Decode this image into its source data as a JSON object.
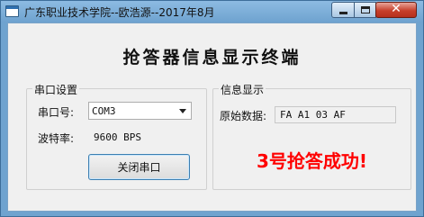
{
  "window": {
    "title": "广东职业技术学院--欧浩源--2017年8月",
    "close_glyph": "✕"
  },
  "heading": "抢答器信息显示终端",
  "serial_group": {
    "legend": "串口设置",
    "port_label": "串口号:",
    "port_value": "COM3",
    "baud_label": "波特率:",
    "baud_value": "9600 BPS",
    "close_port_button": "关闭串口"
  },
  "info_group": {
    "legend": "信息显示",
    "raw_label": "原始数据:",
    "raw_value": "FA A1 03 AF",
    "result_text": "3号抢答成功!"
  },
  "colors": {
    "result": "#ff0000",
    "titlebar": "#6fa3cf",
    "close_button": "#c7402c"
  }
}
